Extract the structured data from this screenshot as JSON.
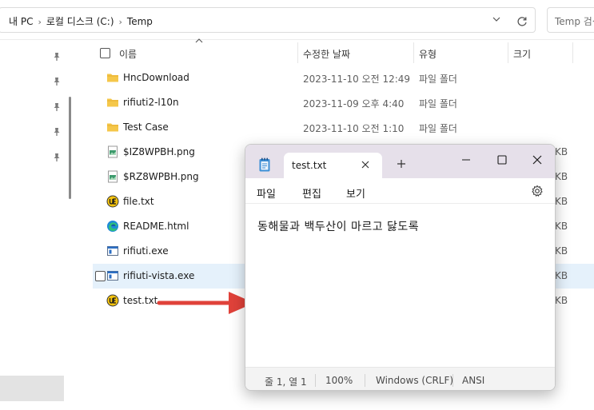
{
  "explorer": {
    "breadcrumb": [
      "내 PC",
      "로컬 디스크 (C:)",
      "Temp"
    ],
    "search_placeholder": "Temp 검색",
    "columns": {
      "name": "이름",
      "date": "수정한 날짜",
      "type": "유형",
      "size": "크기"
    },
    "files": [
      {
        "name": "HncDownload",
        "date": "2023-11-10 오전 12:49",
        "type": "파일 폴더",
        "size": "",
        "icon": "folder-icon"
      },
      {
        "name": "rifiuti2-l10n",
        "date": "2023-11-09 오후 4:40",
        "type": "파일 폴더",
        "size": "",
        "icon": "folder-icon"
      },
      {
        "name": "Test Case",
        "date": "2023-11-10 오전 1:10",
        "type": "파일 폴더",
        "size": "",
        "icon": "folder-icon"
      },
      {
        "name": "$IZ8WPBH.png",
        "date": "",
        "type": "",
        "size": "KB",
        "icon": "png-file-icon"
      },
      {
        "name": "$RZ8WPBH.png",
        "date": "",
        "type": "",
        "size": "KB",
        "icon": "png-file-icon"
      },
      {
        "name": "file.txt",
        "date": "",
        "type": "",
        "size": "KB",
        "icon": "text-file-icon"
      },
      {
        "name": "README.html",
        "date": "",
        "type": "",
        "size": "KB",
        "icon": "edge-html-icon"
      },
      {
        "name": "rifiuti.exe",
        "date": "",
        "type": "",
        "size": "KB",
        "icon": "exe-file-icon"
      },
      {
        "name": "rifiuti-vista.exe",
        "date": "",
        "type": "",
        "size": "KB",
        "icon": "exe-file-icon"
      },
      {
        "name": "test.txt",
        "date": "",
        "type": "",
        "size": "KB",
        "icon": "text-file-icon"
      }
    ]
  },
  "notepad": {
    "tab_title": "test.txt",
    "menu": [
      "파일",
      "편집",
      "보기"
    ],
    "content": "동해물과 백두산이 마르고 닳도록",
    "status": {
      "position": "줄 1, 열 1",
      "zoom": "100%",
      "line_ending": "Windows (CRLF)",
      "encoding": "ANSI"
    }
  },
  "colors": {
    "accent_arrow": "#e0423a",
    "selection": "#e5f1fb",
    "notepad_titlebar": "#e6e0ea",
    "folder": "#f5c74a"
  }
}
